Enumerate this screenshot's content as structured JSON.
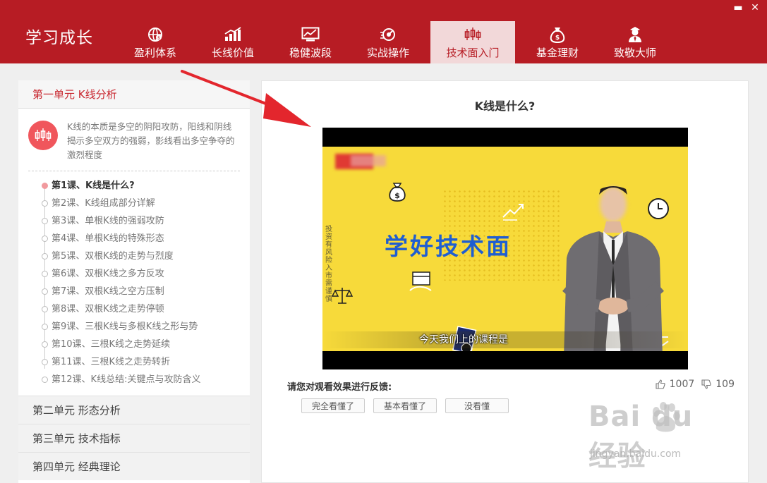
{
  "app": {
    "title": "学习成长",
    "window_controls": {
      "minimize": "▬",
      "close": "✕"
    }
  },
  "nav": {
    "items": [
      {
        "label": "盈利体系",
        "icon": "globe-money-icon"
      },
      {
        "label": "长线价值",
        "icon": "bar-chart-icon"
      },
      {
        "label": "稳健波段",
        "icon": "monitor-chart-icon"
      },
      {
        "label": "实战操作",
        "icon": "target-speed-icon"
      },
      {
        "label": "技术面入门",
        "icon": "candlestick-icon",
        "active": true
      },
      {
        "label": "基金理财",
        "icon": "money-bag-icon"
      },
      {
        "label": "致敬大师",
        "icon": "master-person-icon"
      }
    ]
  },
  "sidebar": {
    "unit1": {
      "title": "第一单元 K线分析",
      "intro": "K线的本质是多空的阴阳攻防，阳线和阴线揭示多空双方的强弱，影线看出多空争夺的激烈程度",
      "lessons": [
        "第1课、K线是什么?",
        "第2课、K线组成部分详解",
        "第3课、单根K线的强弱攻防",
        "第4课、单根K线的特殊形态",
        "第5课、双根K线的走势与烈度",
        "第6课、双根K线之多方反攻",
        "第7课、双根K线之空方压制",
        "第8课、双根K线之走势停顿",
        "第9课、三根K线与多根K线之形与势",
        "第10课、三根K线之走势延续",
        "第11课、三根K线之走势转折",
        "第12课、K线总结:关键点与攻防含义"
      ],
      "current_lesson_index": 0
    },
    "unit2": "第二单元 形态分析",
    "unit3": "第三单元 技术指标",
    "unit4": "第四单元 经典理论"
  },
  "main": {
    "lesson_title": "K线是什么?",
    "video": {
      "headline": "学好技术面",
      "subtitle": "今天我们上的课程是",
      "side_text": "投资有风险 入市需谨慎"
    },
    "feedback_label": "请您对观看效果进行反馈:",
    "likes": "1007",
    "dislikes": "109",
    "feedback_buttons": [
      "完全看懂了",
      "基本看懂了",
      "没看懂"
    ]
  },
  "watermark": {
    "main": "Bai du 经验",
    "sub": "jingyan.baidu.com"
  },
  "colors": {
    "brand_red": "#b71c24",
    "active_tab_bg": "#f2d8d9",
    "accent": "#f0565c",
    "video_bg": "#f7da3a",
    "headline_blue": "#1f5ed1"
  }
}
